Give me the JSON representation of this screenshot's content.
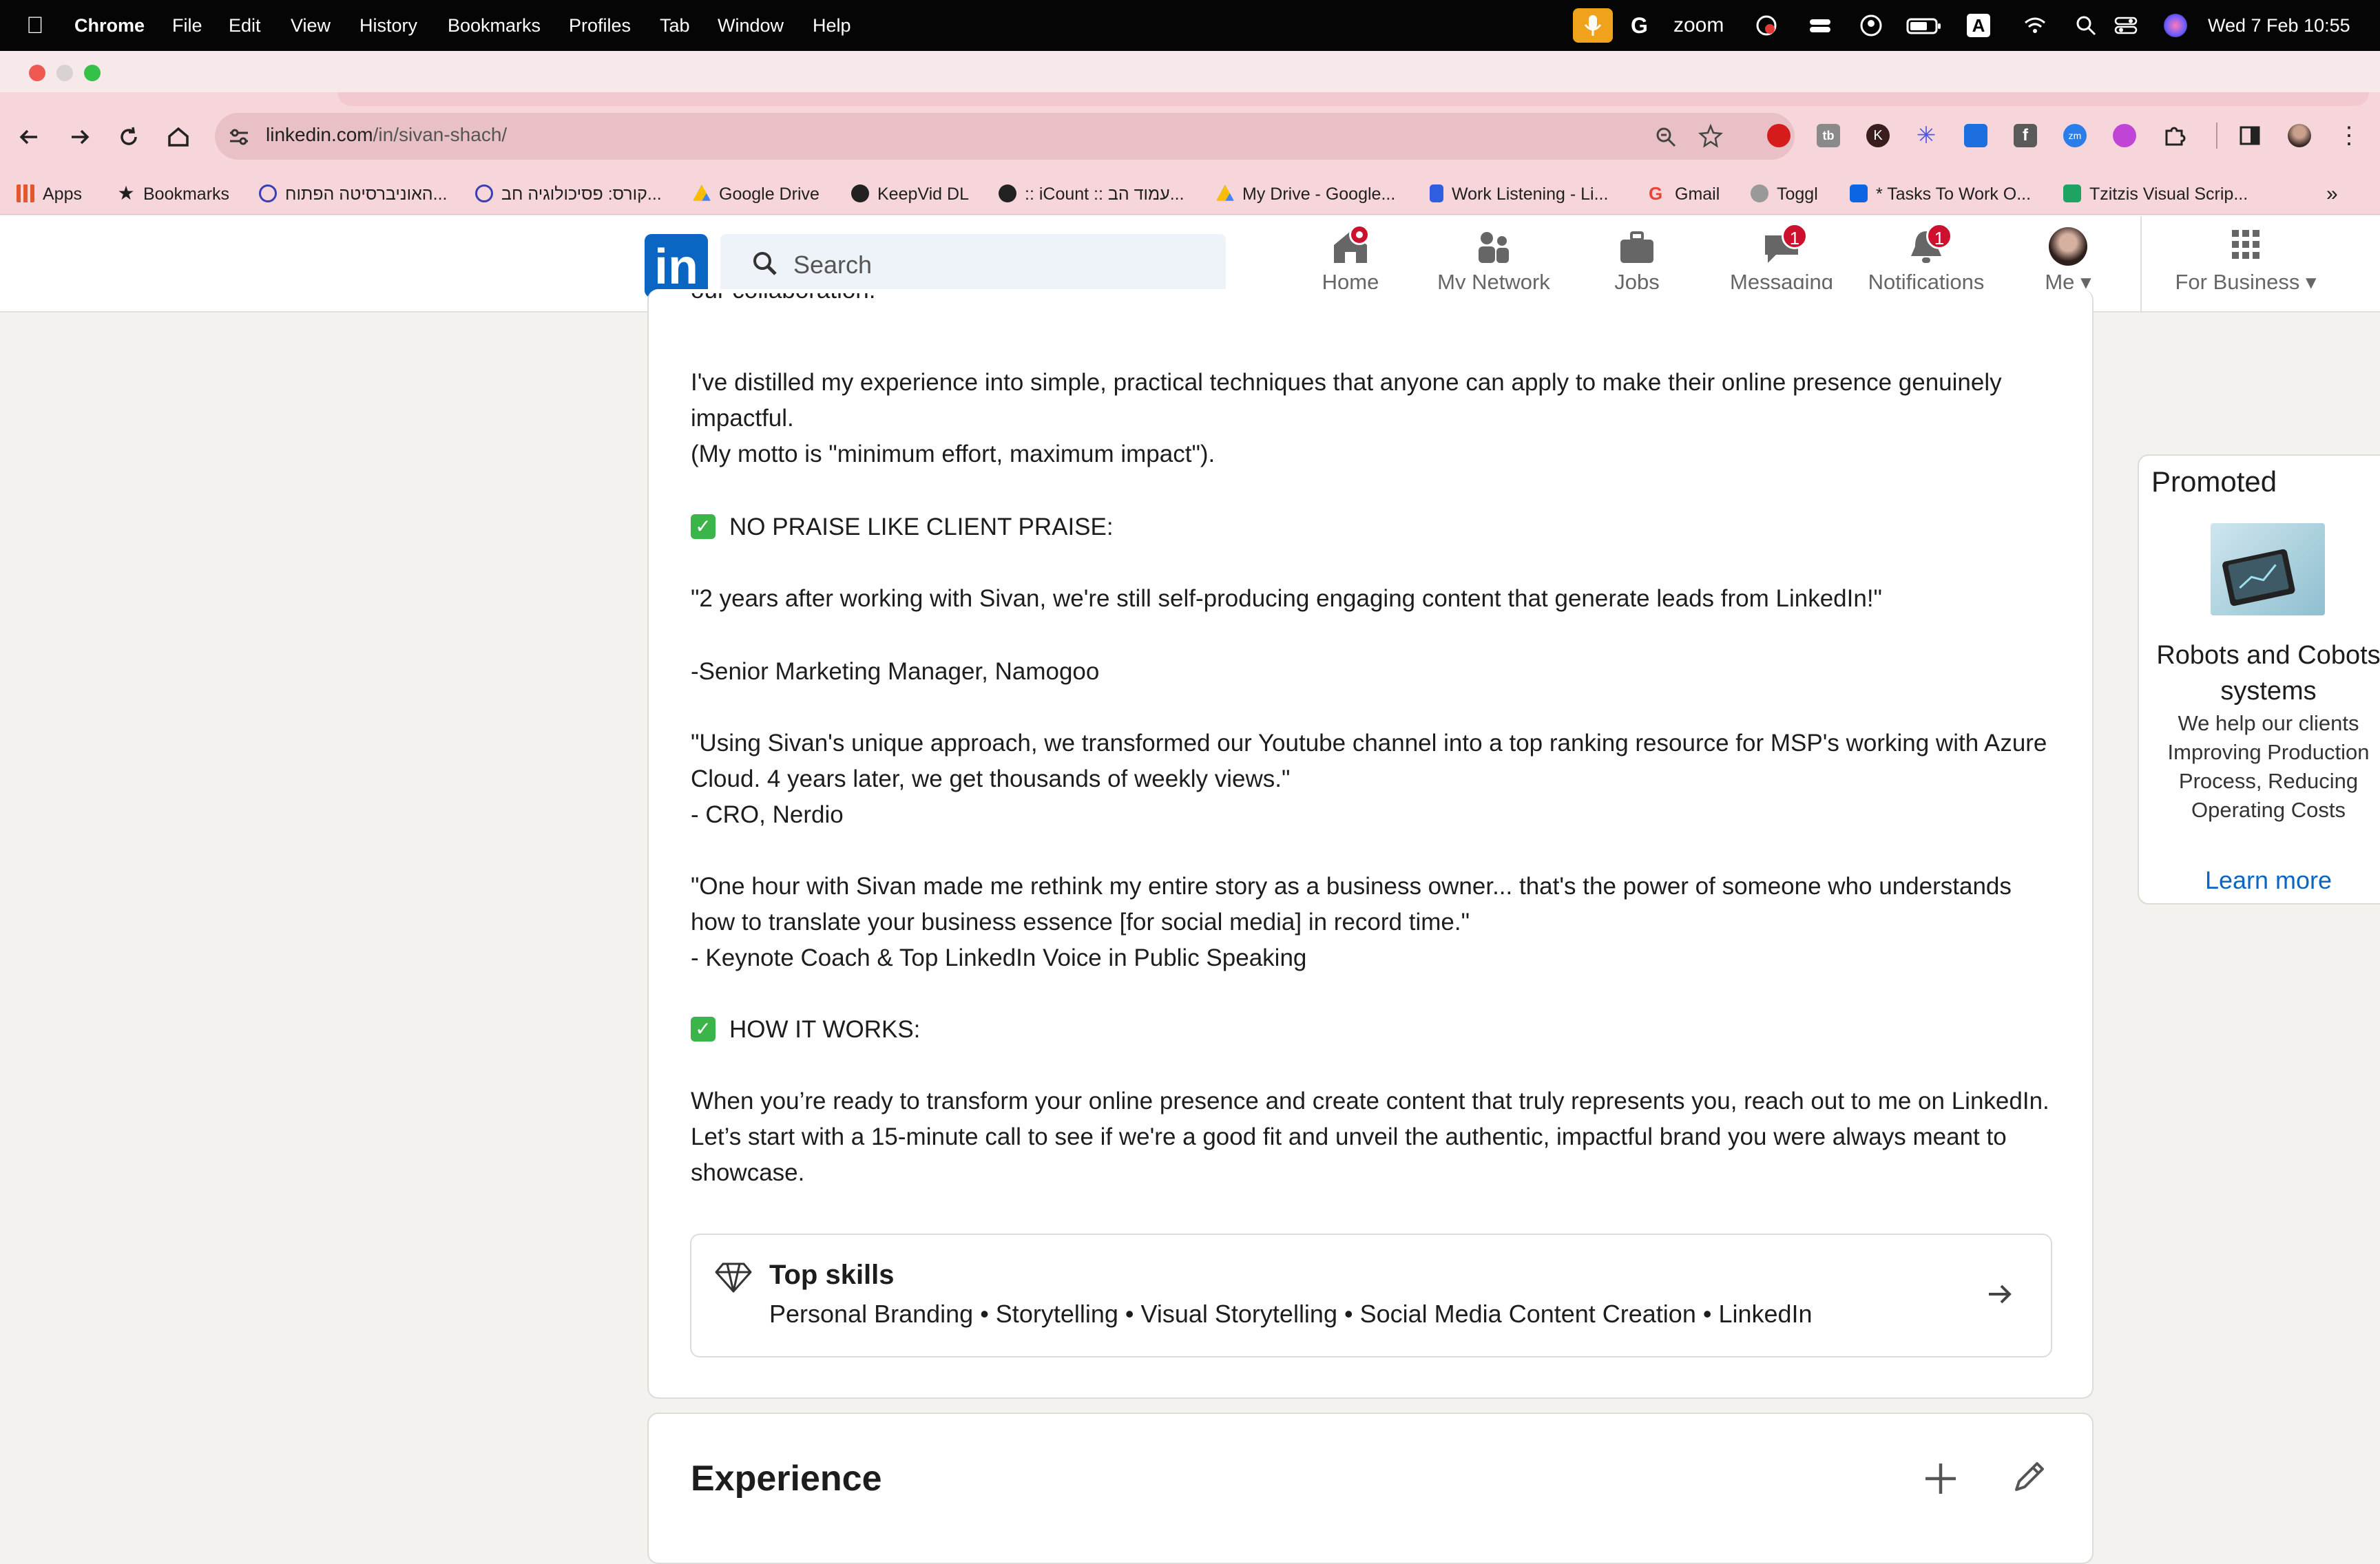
{
  "menubar": {
    "app": "Chrome",
    "menus": [
      "File",
      "Edit",
      "View",
      "History",
      "Bookmarks",
      "Profiles",
      "Tab",
      "Window",
      "Help"
    ],
    "zoom": "zoom",
    "datetime": "Wed 7 Feb  10:55",
    "input_indicator": "A"
  },
  "browser": {
    "url_host": "linkedin.com",
    "url_path": "/in/sivan-shach/"
  },
  "bookmarks": [
    {
      "label": "Apps",
      "icon": "apps-grid-icon",
      "color": "#e4572e"
    },
    {
      "label": "Bookmarks",
      "icon": "star-icon",
      "color": "#333333"
    },
    {
      "label": "האוניברסיטה הפתוח...",
      "icon": "openu-icon",
      "color": "#3b3fb6"
    },
    {
      "label": "קורס: פסיכולוגיה חב...",
      "icon": "openu-icon",
      "color": "#3b3fb6"
    },
    {
      "label": "Google Drive",
      "icon": "drive-icon",
      "color": "#34a853"
    },
    {
      "label": "KeepVid DL",
      "icon": "globe-icon",
      "color": "#222222"
    },
    {
      "label": ":: iCount :: עמוד הב...",
      "icon": "globe-icon",
      "color": "#222222"
    },
    {
      "label": "My Drive - Google...",
      "icon": "drive-icon",
      "color": "#fbbc04"
    },
    {
      "label": "Work Listening - Li...",
      "icon": "pandora-icon",
      "color": "#2f5fe0"
    },
    {
      "label": "Gmail",
      "icon": "google-icon",
      "color": "#ea4335"
    },
    {
      "label": "Toggl",
      "icon": "toggl-icon",
      "color": "#888888"
    },
    {
      "label": "* Tasks To Work O...",
      "icon": "trello-icon",
      "color": "#0c66e4"
    },
    {
      "label": "Tzitzis Visual Scrip...",
      "icon": "sheets-icon",
      "color": "#1ea362"
    }
  ],
  "linkedin": {
    "logo": "in",
    "search_placeholder": "Search",
    "nav": [
      {
        "label": "Home",
        "badge": ""
      },
      {
        "label": "My Network",
        "badge": ""
      },
      {
        "label": "Jobs",
        "badge": ""
      },
      {
        "label": "Messaging",
        "badge": "1"
      },
      {
        "label": "Notifications",
        "badge": "1"
      },
      {
        "label": "Me",
        "badge": ""
      },
      {
        "label": "For Business",
        "badge": ""
      }
    ]
  },
  "about": {
    "cut_line": "our collaboration.",
    "p1": "I've distilled my experience into simple, practical techniques that anyone can apply to make their online presence genuinely impactful.",
    "p1b": "(My motto is \"minimum effort, maximum impact\").",
    "h1": "NO PRAISE LIKE CLIENT PRAISE:",
    "q1": "\"2 years after working with Sivan, we're still self-producing engaging content that generate leads from LinkedIn!\"",
    "q1_author": "-Senior Marketing Manager, Namogoo",
    "q2": "\"Using Sivan's unique approach, we transformed our Youtube channel into a top ranking resource for MSP's working with Azure Cloud. 4 years later, we get thousands of weekly views.\"",
    "q2_author": "- CRO, Nerdio",
    "q3": "\"One hour with Sivan made me rethink my entire story as a business owner... that's the power of someone who understands how to translate your business essence [for social media] in record time.\"",
    "q3_author": "- Keynote Coach & Top LinkedIn Voice in Public Speaking",
    "h2": "HOW IT WORKS:",
    "p2": "When you’re ready to transform your online presence and create content that truly represents you, reach out to me on LinkedIn. Let’s start with a 15-minute call to see if we're a good fit and unveil the authentic, impactful brand you were always meant to showcase.",
    "check_glyph": "✓"
  },
  "top_skills": {
    "title": "Top skills",
    "list": "Personal Branding • Storytelling • Visual Storytelling • Social Media Content Creation • LinkedIn"
  },
  "experience": {
    "title": "Experience"
  },
  "promoted": {
    "label": "Promoted",
    "title": "Robots and Cobots systems",
    "description": "We help our clients Improving Production Process, Reducing Operating Costs",
    "cta": "Learn more"
  }
}
